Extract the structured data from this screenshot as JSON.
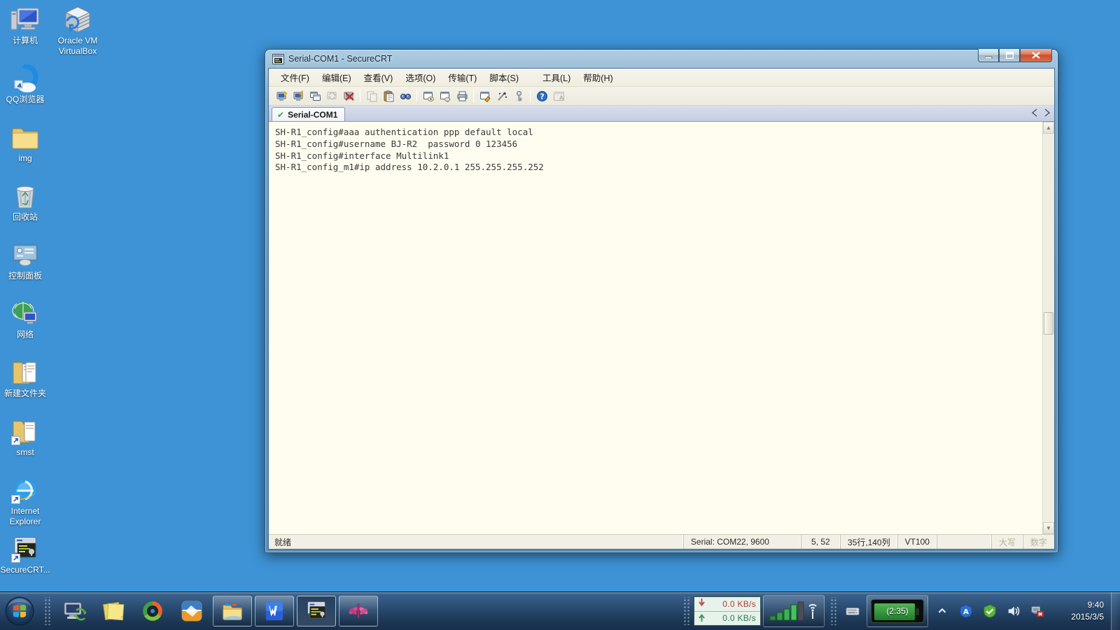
{
  "desktop": {
    "icons": [
      {
        "name": "computer",
        "label": "计算机"
      },
      {
        "name": "virtualbox",
        "label": "Oracle VM VirtualBox"
      },
      {
        "name": "qq-browser",
        "label": "QQ浏览器"
      },
      {
        "name": "img-folder",
        "label": "img"
      },
      {
        "name": "recycle-bin",
        "label": "回收站"
      },
      {
        "name": "control-panel",
        "label": "控制面板"
      },
      {
        "name": "network",
        "label": "网络"
      },
      {
        "name": "new-folder",
        "label": "新建文件夹"
      },
      {
        "name": "smst-folder",
        "label": "smst"
      },
      {
        "name": "internet-explorer",
        "label": "Internet Explorer"
      },
      {
        "name": "securecrt-shortcut",
        "label": "SecureCRT..."
      }
    ]
  },
  "window": {
    "title": "Serial-COM1 - SecureCRT",
    "menu": [
      "文件(F)",
      "编辑(E)",
      "查看(V)",
      "选项(O)",
      "传输(T)",
      "脚本(S)",
      "工具(L)",
      "帮助(H)"
    ],
    "toolbar_icons": [
      "quick-connect",
      "connect",
      "connect-in-tab",
      "reconnect",
      "disconnect",
      "copy",
      "paste",
      "find",
      "session-log",
      "transfer",
      "print",
      "session-options",
      "global-options",
      "keygen",
      "help",
      "about"
    ],
    "tab": {
      "label": "Serial-COM1"
    },
    "terminal_lines": [
      "SH-R1_config#aaa authentication ppp default local",
      "SH-R1_config#username BJ-R2  password 0 123456",
      "SH-R1_config#interface Multilink1",
      "SH-R1_config_m1#ip address 10.2.0.1 255.255.255.252"
    ],
    "status": {
      "ready": "就绪",
      "serial": "Serial: COM22, 9600",
      "cursor": "5, 52",
      "size": "35行,140列",
      "emulation": "VT100",
      "caps": "大写",
      "num": "数字"
    },
    "colors": {
      "terminal_bg": "#FFFDF0",
      "titlebar": "#6495BA",
      "chrome": "#F2F0E3"
    }
  },
  "taskbar": {
    "app_icons": [
      "remote-desktop",
      "sticky-notes",
      "media-player",
      "vmware",
      "explorer",
      "wps-writer",
      "securecrt",
      "dragonfly-app"
    ],
    "tray_icons": [
      "hidden-icons",
      "security-a",
      "shield-green",
      "volume",
      "device-error"
    ],
    "tray": {
      "down_speed": "0.0 KB/s",
      "up_speed": "0.0 KB/s",
      "battery": "(2:35)",
      "time": "9:40",
      "date": "2015/3/5"
    }
  }
}
